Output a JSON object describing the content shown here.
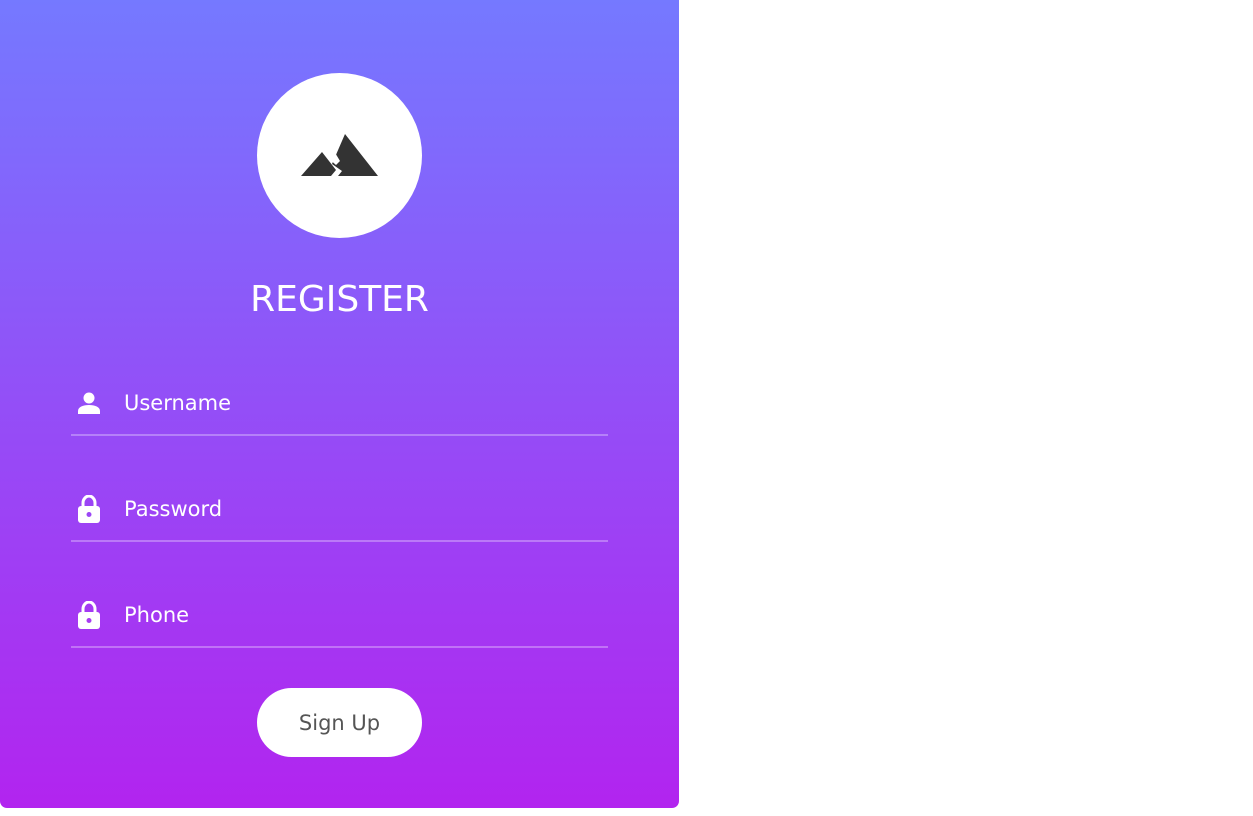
{
  "form": {
    "title": "REGISTER",
    "logo_icon": "mountain-icon",
    "fields": [
      {
        "placeholder": "Username",
        "value": "",
        "icon": "user-icon"
      },
      {
        "placeholder": "Password",
        "value": "",
        "icon": "lock-icon"
      },
      {
        "placeholder": "Phone",
        "value": "",
        "icon": "lock-icon"
      }
    ],
    "submit_label": "Sign Up"
  },
  "colors": {
    "gradient_top": "#7579ff",
    "gradient_bottom": "#b224ef",
    "button_text": "#555555",
    "logo_icon": "#333333"
  }
}
